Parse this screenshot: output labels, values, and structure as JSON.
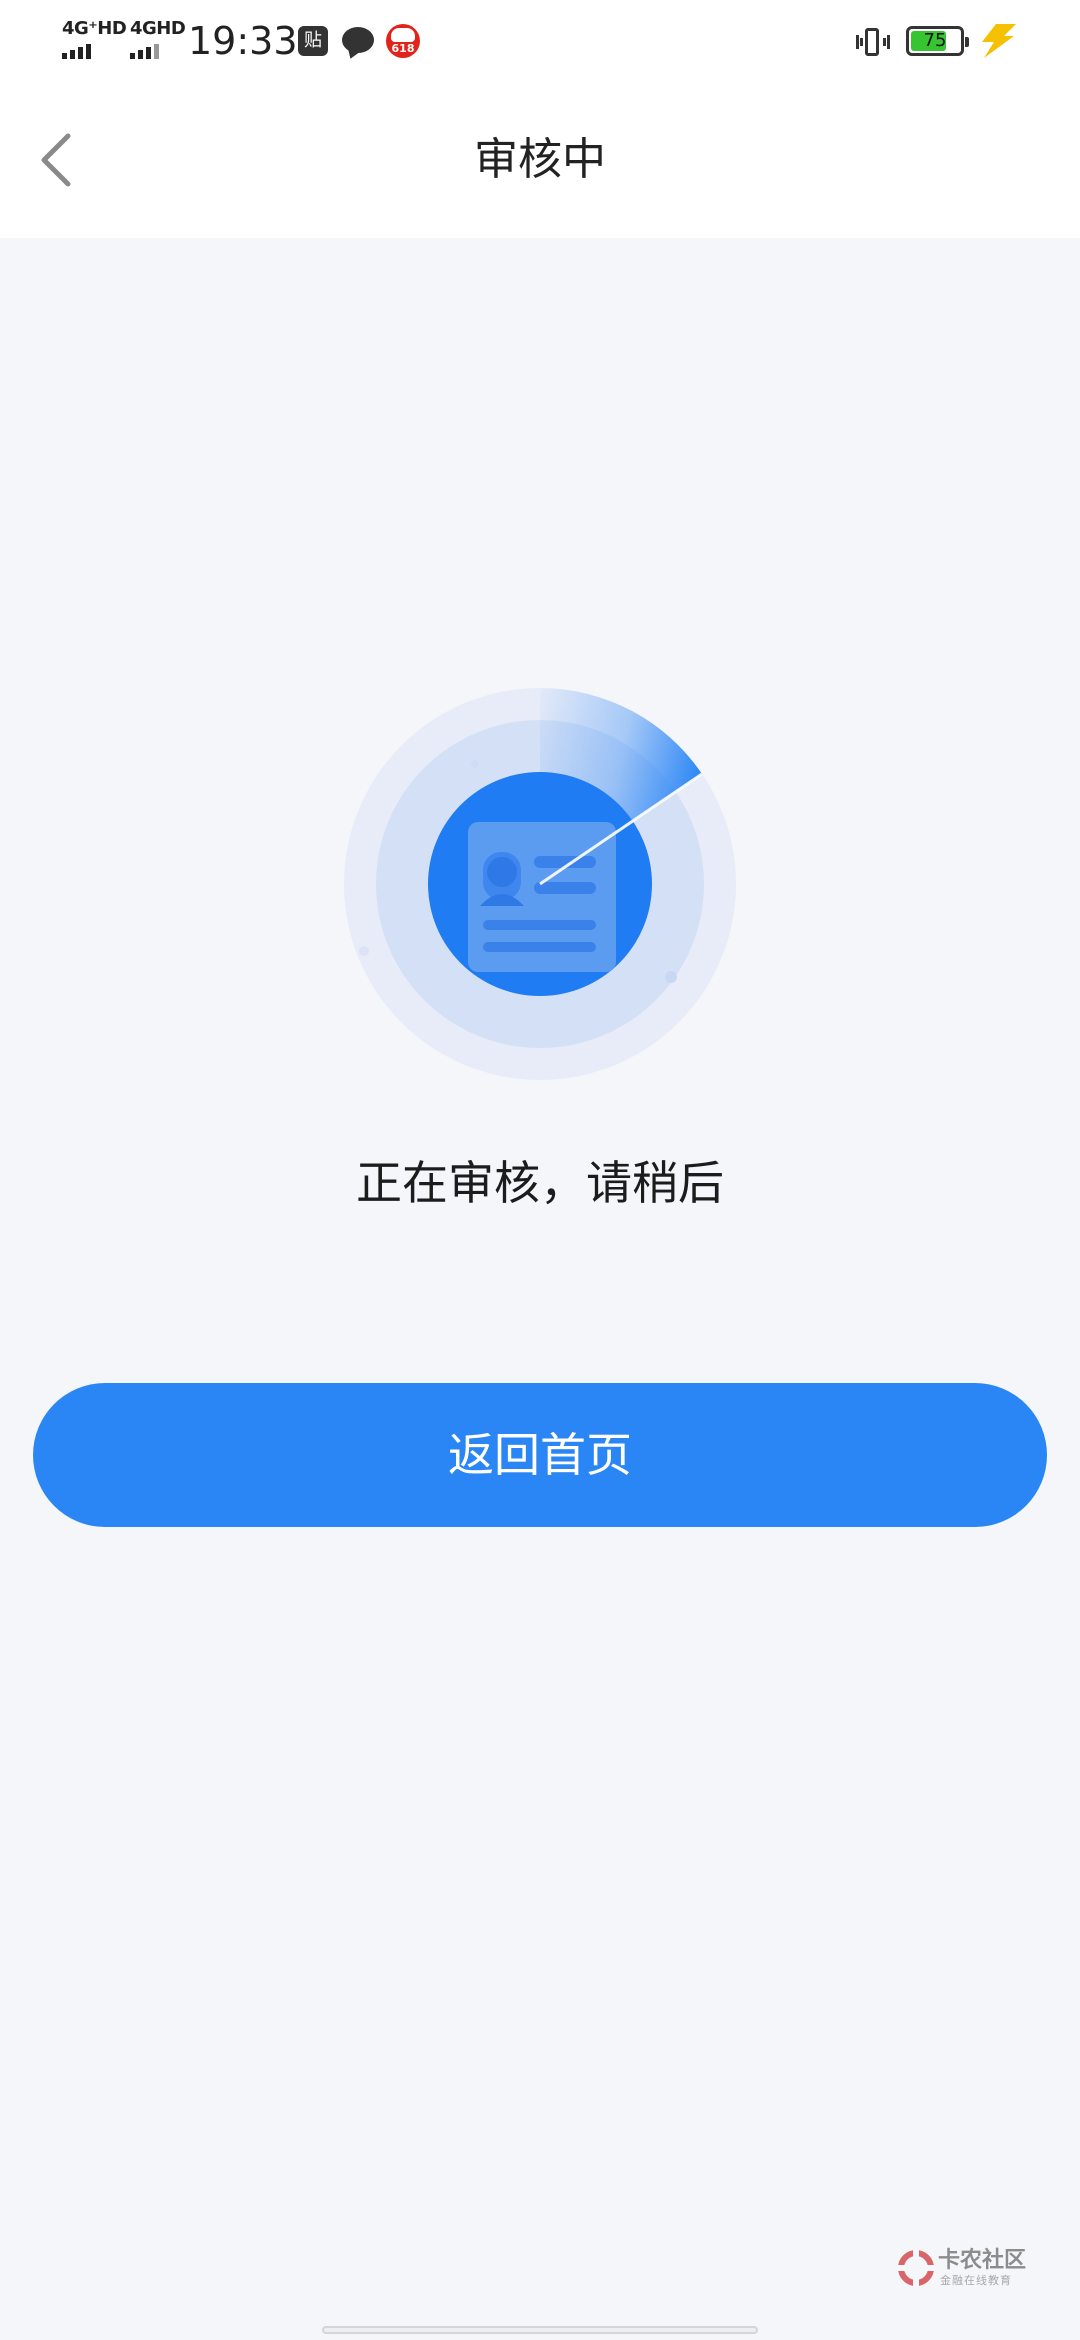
{
  "status_bar": {
    "network_1": "4G⁺HD",
    "network_2": "4GHD",
    "time": "19:33",
    "notification_tie": "贴",
    "notification_618": "618",
    "battery_level": "75",
    "battery_fraction": 0.75,
    "battery_color": "#37c431",
    "charging_color": "#f5c000",
    "icons": [
      "vibrate-icon",
      "battery-icon",
      "charging-bolt-icon"
    ]
  },
  "nav": {
    "title": "审核中",
    "back_icon": "chevron-left-icon"
  },
  "main": {
    "illustration_icon": "id-card-scanning-icon",
    "status_message": "正在审核，请稍后",
    "home_button_label": "返回首页"
  },
  "watermark": {
    "title": "卡农社区",
    "subtitle": "金融在线教育"
  },
  "colors": {
    "accent": "#2b86f5",
    "background": "#f4f6f9",
    "header_bg": "#ffffff",
    "text_primary": "#1c1c1c"
  }
}
